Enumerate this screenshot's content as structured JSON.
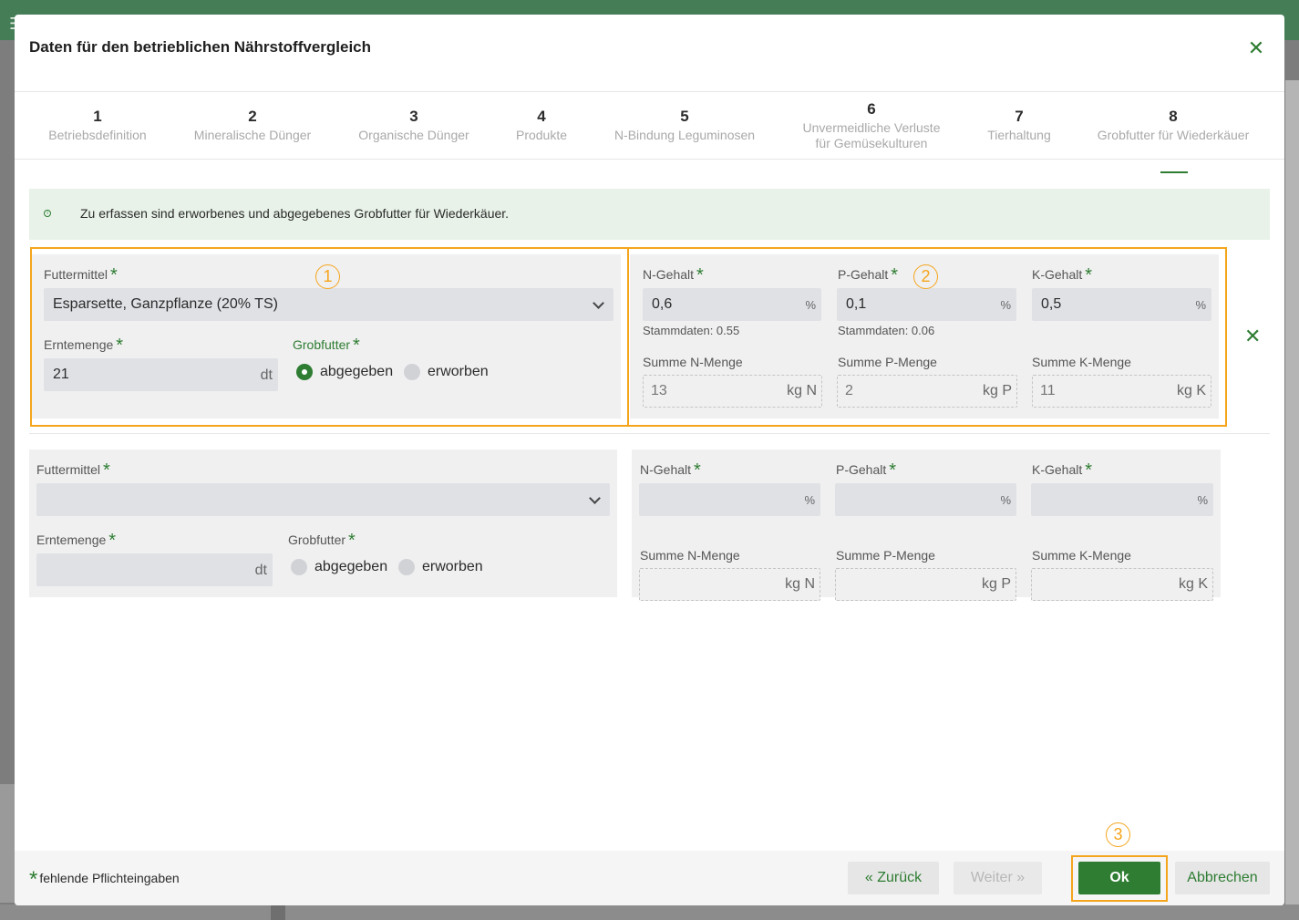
{
  "dialog": {
    "title": "Daten für den betrieblichen Nährstoffvergleich"
  },
  "steps": [
    {
      "num": "1",
      "label": "Betriebsdefinition"
    },
    {
      "num": "2",
      "label": "Mineralische Dünger"
    },
    {
      "num": "3",
      "label": "Organische Dünger"
    },
    {
      "num": "4",
      "label": "Produkte"
    },
    {
      "num": "5",
      "label": "N-Bindung Leguminosen"
    },
    {
      "num": "6",
      "label": "Unvermeidliche Verluste",
      "label2": "für Gemüsekulturen"
    },
    {
      "num": "7",
      "label": "Tierhaltung"
    },
    {
      "num": "8",
      "label": "Grobfutter für Wiederkäuer",
      "active": true
    }
  ],
  "info": {
    "text": "Zu erfassen sind erworbenes und abgegebenes Grobfutter für Wiederkäuer.",
    "icon": "info-icon"
  },
  "labels": {
    "futtermittel": "Futtermittel",
    "erntemenge": "Erntemenge",
    "grobfutter": "Grobfutter",
    "abgegeben": "abgegeben",
    "erworben": "erworben",
    "n_gehalt": "N-Gehalt",
    "p_gehalt": "P-Gehalt",
    "k_gehalt": "K-Gehalt",
    "summe_n": "Summe N-Menge",
    "summe_p": "Summe P-Menge",
    "summe_k": "Summe K-Menge",
    "star": "*"
  },
  "units": {
    "percent": "%",
    "dt": "dt",
    "kgN": "kg N",
    "kgP": "kg P",
    "kgK": "kg K"
  },
  "rows": [
    {
      "futtermittel": "Esparsette, Ganzpflanze (20% TS)",
      "erntemenge": "21",
      "grobfutter": "abgegeben",
      "n_gehalt": "0,6",
      "p_gehalt": "0,1",
      "k_gehalt": "0,5",
      "n_stamm": "Stammdaten: 0.55",
      "p_stamm": "Stammdaten: 0.06",
      "summe_n": "13",
      "summe_p": "2",
      "summe_k": "11"
    },
    {
      "futtermittel": "",
      "erntemenge": "",
      "grobfutter": "",
      "n_gehalt": "",
      "p_gehalt": "",
      "k_gehalt": "",
      "summe_n": "",
      "summe_p": "",
      "summe_k": ""
    }
  ],
  "annotations": [
    "1",
    "2",
    "3"
  ],
  "footer": {
    "required_note": "fehlende Pflichteingaben",
    "back": "Zurück",
    "next": "Weiter",
    "ok": "Ok",
    "cancel": "Abbrechen"
  },
  "colors": {
    "accent": "#2e7d32",
    "annotation": "#f5a51c",
    "header_bg": "#457d57"
  }
}
